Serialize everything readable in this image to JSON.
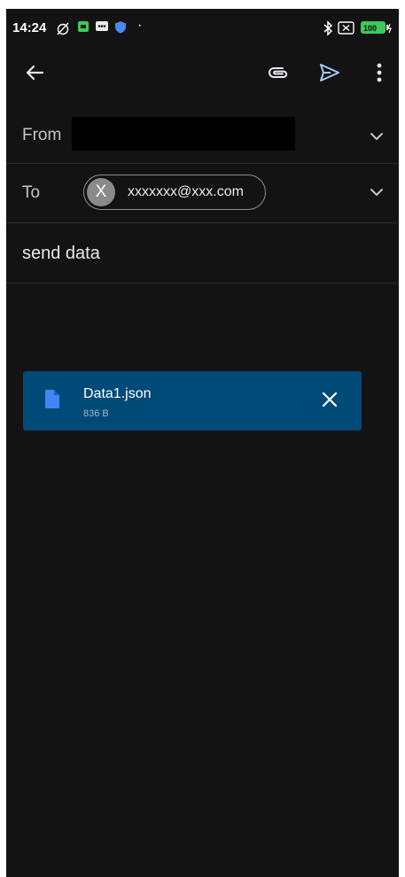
{
  "status_bar": {
    "time": "14:24",
    "battery": "100"
  },
  "compose": {
    "from_label": "From",
    "to_label": "To",
    "recipient": {
      "initial": "X",
      "email": "xxxxxxx@xxx.com"
    },
    "subject": "send data",
    "attachment": {
      "name": "Data1.json",
      "size": "836 B"
    }
  },
  "colors": {
    "background": "#131313",
    "send_icon": "#a8c7fa",
    "attachment_bg": "#004a77",
    "attachment_file_icon": "#4285f4"
  },
  "icons": {
    "back": "arrow-left-icon",
    "attach": "paperclip-icon",
    "send": "send-icon",
    "more": "more-vert-icon",
    "expand": "chevron-down-icon",
    "file": "file-icon",
    "remove": "close-icon"
  }
}
